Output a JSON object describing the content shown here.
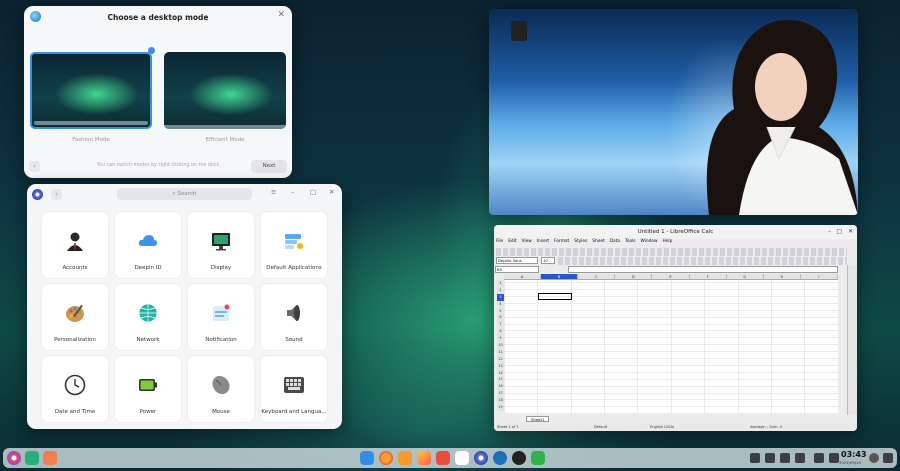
{
  "mode_dialog": {
    "title": "Choose a desktop mode",
    "modes": [
      {
        "label": "Fashion Mode",
        "selected": true
      },
      {
        "label": "Efficient Mode",
        "selected": false
      }
    ],
    "hint": "You can switch modes by right clicking on the dock",
    "next_label": "Next"
  },
  "control_center": {
    "search_placeholder": "Search",
    "tiles": [
      {
        "label": "Accounts",
        "icon": "accounts-icon"
      },
      {
        "label": "Deepin ID",
        "icon": "cloud-icon"
      },
      {
        "label": "Display",
        "icon": "display-icon"
      },
      {
        "label": "Default Applications",
        "icon": "default-apps-icon"
      },
      {
        "label": "Personalization",
        "icon": "palette-icon"
      },
      {
        "label": "Network",
        "icon": "network-icon"
      },
      {
        "label": "Notification",
        "icon": "notification-icon"
      },
      {
        "label": "Sound",
        "icon": "speaker-icon"
      },
      {
        "label": "Date and Time",
        "icon": "clock-icon"
      },
      {
        "label": "Power",
        "icon": "battery-icon"
      },
      {
        "label": "Mouse",
        "icon": "mouse-icon"
      },
      {
        "label": "Keyboard and Langua...",
        "icon": "keyboard-icon"
      }
    ]
  },
  "calc": {
    "title": "Untitled 1 - LibreOffice Calc",
    "menu": [
      "File",
      "Edit",
      "View",
      "Insert",
      "Format",
      "Styles",
      "Sheet",
      "Data",
      "Tools",
      "Window",
      "Help"
    ],
    "font_name": "DejaVu Sans",
    "font_size": "10",
    "cell_ref": "B3",
    "columns": [
      "A",
      "B",
      "C",
      "D",
      "E",
      "F",
      "G",
      "H",
      "I"
    ],
    "rows": [
      "1",
      "2",
      "3",
      "4",
      "5",
      "6",
      "7",
      "8",
      "9",
      "10",
      "11",
      "12",
      "13",
      "14",
      "15",
      "16",
      "17",
      "18",
      "19"
    ],
    "sheet_tab": "Sheet1",
    "status": {
      "sheet": "Sheet 1 of 1",
      "style": "Default",
      "lang": "English (USA)",
      "agg": "Average: ; Sum: 0"
    }
  },
  "dock": {
    "time": "03:43",
    "date": "2022/09/19",
    "colors": {
      "launcher": "#e84a5f",
      "taskview": "#24b27a",
      "calendar": "#f59a2c"
    }
  }
}
